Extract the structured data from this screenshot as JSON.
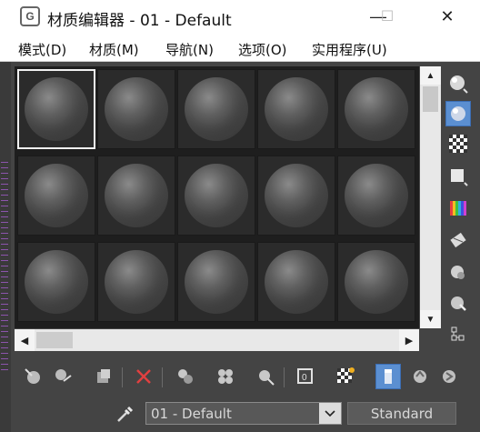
{
  "window": {
    "title": "材质编辑器 - 01 - Default",
    "app_icon_glyph": "G",
    "minimize_glyph": "—",
    "maximize_glyph": "☐",
    "close_glyph": "✕"
  },
  "menu": [
    {
      "label": "模式(D)"
    },
    {
      "label": "材质(M)"
    },
    {
      "label": "导航(N)"
    },
    {
      "label": "选项(O)"
    },
    {
      "label": "实用程序(U)"
    }
  ],
  "slots": {
    "rows": 3,
    "cols": 5,
    "selected_index": 0,
    "sphere_icon": "material-sample-sphere"
  },
  "scrollbars": {
    "up_arrow": "▲",
    "down_arrow": "▼",
    "left_arrow": "◀",
    "right_arrow": "▶"
  },
  "side_toolbar": [
    "sample-type-sphere-icon",
    "backlight-icon",
    "background-checker-icon",
    "sample-uv-tiling-icon",
    "video-color-check-icon",
    "make-preview-icon",
    "material-options-icon",
    "select-by-material-icon",
    "material-map-navigator-icon"
  ],
  "bottom_toolbar": [
    "get-material-icon",
    "put-material-to-scene-icon",
    "assign-material-to-selection-icon",
    "reset-map-icon",
    "make-material-copy-icon",
    "make-unique-icon",
    "put-to-library-icon",
    "material-id-channel-icon",
    "show-shaded-material-in-viewport-icon",
    "show-end-result-icon",
    "go-to-parent-icon",
    "go-forward-to-sibling-icon"
  ],
  "material_name": "01 - Default",
  "material_type": "Standard",
  "colors": {
    "accent": "#5b8fd1",
    "panel": "#444444",
    "slot_bg": "#2b2b2b",
    "reset_red": "#e04040"
  }
}
